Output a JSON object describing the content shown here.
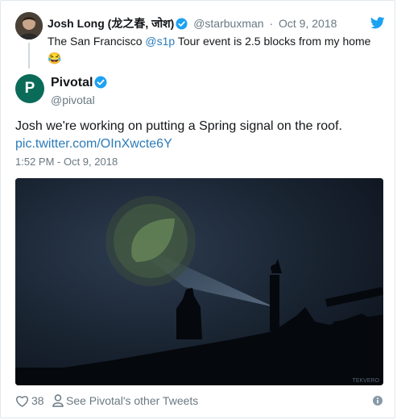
{
  "reply_tweet": {
    "author_name": "Josh Long (龙之春, जोश)",
    "handle": "@starbuxman",
    "separator": "·",
    "date": "Oct 9, 2018",
    "text_before": "The San Francisco ",
    "mention": "@s1p",
    "text_after": " Tour event is 2.5 blocks from my home",
    "emoji": "😂"
  },
  "main_tweet": {
    "avatar_letter": "P",
    "author_name": "Pivotal",
    "handle": "@pivotal",
    "text": "Josh we're working on putting a Spring signal on the roof.",
    "link": "pic.twitter.com/OInXwcte6Y",
    "timestamp": "1:52 PM - Oct 9, 2018",
    "media_watermark": "TEKVERO"
  },
  "actions": {
    "like_count": "38",
    "see_other": "See Pivotal's other Tweets"
  },
  "icons": {
    "verified": "verified-badge-icon",
    "bird": "twitter-bird-icon",
    "like": "heart-icon",
    "person": "person-icon",
    "info": "info-icon"
  },
  "colors": {
    "link": "#2b7bb9",
    "verified": "#1da1f2",
    "muted": "#697882",
    "brand_avatar": "#0b6b59"
  }
}
